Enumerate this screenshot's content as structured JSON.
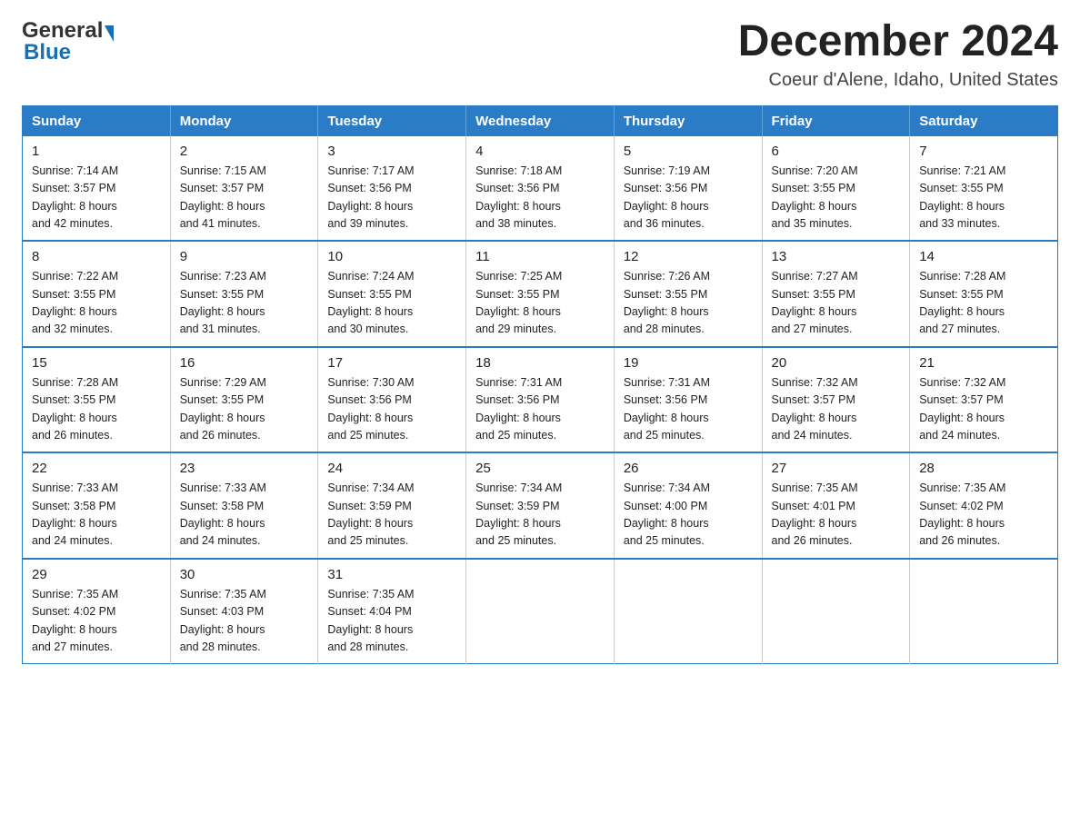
{
  "logo": {
    "general": "General",
    "blue": "Blue"
  },
  "title": {
    "month": "December 2024",
    "location": "Coeur d'Alene, Idaho, United States"
  },
  "days_of_week": [
    "Sunday",
    "Monday",
    "Tuesday",
    "Wednesday",
    "Thursday",
    "Friday",
    "Saturday"
  ],
  "weeks": [
    [
      {
        "day": "1",
        "sunrise": "7:14 AM",
        "sunset": "3:57 PM",
        "daylight": "8 hours and 42 minutes."
      },
      {
        "day": "2",
        "sunrise": "7:15 AM",
        "sunset": "3:57 PM",
        "daylight": "8 hours and 41 minutes."
      },
      {
        "day": "3",
        "sunrise": "7:17 AM",
        "sunset": "3:56 PM",
        "daylight": "8 hours and 39 minutes."
      },
      {
        "day": "4",
        "sunrise": "7:18 AM",
        "sunset": "3:56 PM",
        "daylight": "8 hours and 38 minutes."
      },
      {
        "day": "5",
        "sunrise": "7:19 AM",
        "sunset": "3:56 PM",
        "daylight": "8 hours and 36 minutes."
      },
      {
        "day": "6",
        "sunrise": "7:20 AM",
        "sunset": "3:55 PM",
        "daylight": "8 hours and 35 minutes."
      },
      {
        "day": "7",
        "sunrise": "7:21 AM",
        "sunset": "3:55 PM",
        "daylight": "8 hours and 33 minutes."
      }
    ],
    [
      {
        "day": "8",
        "sunrise": "7:22 AM",
        "sunset": "3:55 PM",
        "daylight": "8 hours and 32 minutes."
      },
      {
        "day": "9",
        "sunrise": "7:23 AM",
        "sunset": "3:55 PM",
        "daylight": "8 hours and 31 minutes."
      },
      {
        "day": "10",
        "sunrise": "7:24 AM",
        "sunset": "3:55 PM",
        "daylight": "8 hours and 30 minutes."
      },
      {
        "day": "11",
        "sunrise": "7:25 AM",
        "sunset": "3:55 PM",
        "daylight": "8 hours and 29 minutes."
      },
      {
        "day": "12",
        "sunrise": "7:26 AM",
        "sunset": "3:55 PM",
        "daylight": "8 hours and 28 minutes."
      },
      {
        "day": "13",
        "sunrise": "7:27 AM",
        "sunset": "3:55 PM",
        "daylight": "8 hours and 27 minutes."
      },
      {
        "day": "14",
        "sunrise": "7:28 AM",
        "sunset": "3:55 PM",
        "daylight": "8 hours and 27 minutes."
      }
    ],
    [
      {
        "day": "15",
        "sunrise": "7:28 AM",
        "sunset": "3:55 PM",
        "daylight": "8 hours and 26 minutes."
      },
      {
        "day": "16",
        "sunrise": "7:29 AM",
        "sunset": "3:55 PM",
        "daylight": "8 hours and 26 minutes."
      },
      {
        "day": "17",
        "sunrise": "7:30 AM",
        "sunset": "3:56 PM",
        "daylight": "8 hours and 25 minutes."
      },
      {
        "day": "18",
        "sunrise": "7:31 AM",
        "sunset": "3:56 PM",
        "daylight": "8 hours and 25 minutes."
      },
      {
        "day": "19",
        "sunrise": "7:31 AM",
        "sunset": "3:56 PM",
        "daylight": "8 hours and 25 minutes."
      },
      {
        "day": "20",
        "sunrise": "7:32 AM",
        "sunset": "3:57 PM",
        "daylight": "8 hours and 24 minutes."
      },
      {
        "day": "21",
        "sunrise": "7:32 AM",
        "sunset": "3:57 PM",
        "daylight": "8 hours and 24 minutes."
      }
    ],
    [
      {
        "day": "22",
        "sunrise": "7:33 AM",
        "sunset": "3:58 PM",
        "daylight": "8 hours and 24 minutes."
      },
      {
        "day": "23",
        "sunrise": "7:33 AM",
        "sunset": "3:58 PM",
        "daylight": "8 hours and 24 minutes."
      },
      {
        "day": "24",
        "sunrise": "7:34 AM",
        "sunset": "3:59 PM",
        "daylight": "8 hours and 25 minutes."
      },
      {
        "day": "25",
        "sunrise": "7:34 AM",
        "sunset": "3:59 PM",
        "daylight": "8 hours and 25 minutes."
      },
      {
        "day": "26",
        "sunrise": "7:34 AM",
        "sunset": "4:00 PM",
        "daylight": "8 hours and 25 minutes."
      },
      {
        "day": "27",
        "sunrise": "7:35 AM",
        "sunset": "4:01 PM",
        "daylight": "8 hours and 26 minutes."
      },
      {
        "day": "28",
        "sunrise": "7:35 AM",
        "sunset": "4:02 PM",
        "daylight": "8 hours and 26 minutes."
      }
    ],
    [
      {
        "day": "29",
        "sunrise": "7:35 AM",
        "sunset": "4:02 PM",
        "daylight": "8 hours and 27 minutes."
      },
      {
        "day": "30",
        "sunrise": "7:35 AM",
        "sunset": "4:03 PM",
        "daylight": "8 hours and 28 minutes."
      },
      {
        "day": "31",
        "sunrise": "7:35 AM",
        "sunset": "4:04 PM",
        "daylight": "8 hours and 28 minutes."
      },
      null,
      null,
      null,
      null
    ]
  ],
  "labels": {
    "sunrise_prefix": "Sunrise: ",
    "sunset_prefix": "Sunset: ",
    "daylight_prefix": "Daylight: "
  }
}
